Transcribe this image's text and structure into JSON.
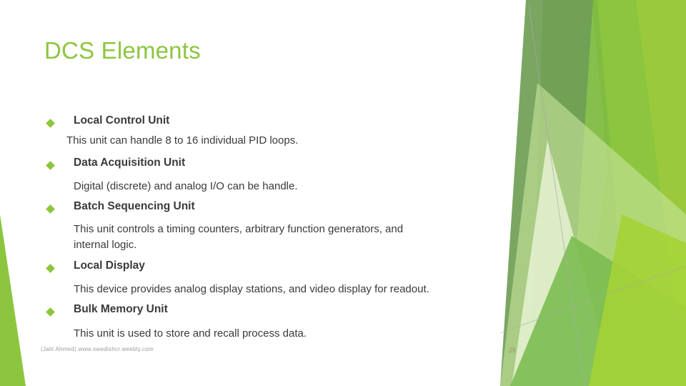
{
  "slide": {
    "title": "DCS Elements",
    "title_color": "#8CC63E",
    "background_color": "#FFFFFF",
    "body_text_color": "#3A3A38"
  },
  "bullets": [
    {
      "heading": "Local Control Unit",
      "lines": [
        "This unit can handle 8 to 16 individual PID loops."
      ]
    },
    {
      "heading": "Data Acquisition Unit",
      "lines": [
        "Digital (discrete) and analog I/O can be handle."
      ]
    },
    {
      "heading": "Batch Sequencing Unit",
      "lines": [
        "This unit controls a timing counters, arbitrary function generators, and",
        "internal logic."
      ]
    },
    {
      "heading": "Local Display",
      "lines": [
        "This device provides analog display stations, and video display for readout."
      ]
    },
    {
      "heading": "Bulk Memory Unit",
      "lines": [
        "This unit is used to store and recall process data."
      ]
    }
  ],
  "footer": {
    "credit": "(Jalil Ahmed) www.swedishcr.weebly.com",
    "page_number": "25"
  },
  "decoration": {
    "accent_bright": "#8CC63E",
    "accent_light": "#A6D44C",
    "accent_medium": "#73B33F",
    "accent_dark": "#6C9A51",
    "accent_pale": "#DCEDC0",
    "accent_palest": "#EDF5DC",
    "hairline": "#A9A9A9"
  }
}
